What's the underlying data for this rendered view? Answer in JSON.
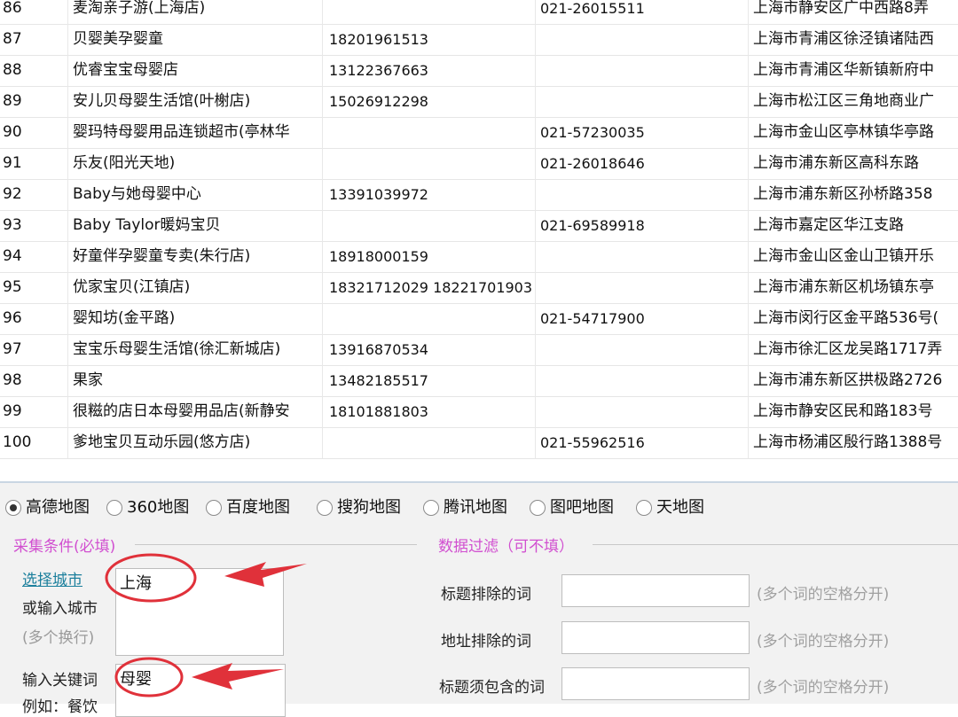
{
  "table": {
    "rows": [
      {
        "num": "86",
        "name": "麦淘亲子游(上海店)",
        "mobile": "",
        "tel": "021-26015511",
        "addr": "上海市静安区广中西路8弄"
      },
      {
        "num": "87",
        "name": "贝婴美孕婴童",
        "mobile": "18201961513",
        "tel": "",
        "addr": "上海市青浦区徐泾镇诸陆西"
      },
      {
        "num": "88",
        "name": "优睿宝宝母婴店",
        "mobile": "13122367663",
        "tel": "",
        "addr": "上海市青浦区华新镇新府中"
      },
      {
        "num": "89",
        "name": "安儿贝母婴生活馆(叶榭店)",
        "mobile": "15026912298",
        "tel": "",
        "addr": "上海市松江区三角地商业广"
      },
      {
        "num": "90",
        "name": "婴玛特母婴用品连锁超市(亭林华",
        "mobile": "",
        "tel": "021-57230035",
        "addr": "上海市金山区亭林镇华亭路"
      },
      {
        "num": "91",
        "name": "乐友(阳光天地)",
        "mobile": "",
        "tel": "021-26018646",
        "addr": "上海市浦东新区高科东路"
      },
      {
        "num": "92",
        "name": "Baby与她母婴中心",
        "mobile": "13391039972",
        "tel": "",
        "addr": "上海市浦东新区孙桥路358"
      },
      {
        "num": "93",
        "name": "Baby Taylor暖妈宝贝",
        "mobile": "",
        "tel": "021-69589918",
        "addr": "上海市嘉定区华江支路"
      },
      {
        "num": "94",
        "name": "好童伴孕婴童专卖(朱行店)",
        "mobile": "18918000159",
        "tel": "",
        "addr": "上海市金山区金山卫镇开乐"
      },
      {
        "num": "95",
        "name": "优家宝贝(江镇店)",
        "mobile": "18321712029 18221701903",
        "tel": "",
        "addr": "上海市浦东新区机场镇东亭"
      },
      {
        "num": "96",
        "name": "婴知坊(金平路)",
        "mobile": "",
        "tel": "021-54717900",
        "addr": "上海市闵行区金平路536号("
      },
      {
        "num": "97",
        "name": "宝宝乐母婴生活馆(徐汇新城店)",
        "mobile": "13916870534",
        "tel": "",
        "addr": "上海市徐汇区龙吴路1717弄"
      },
      {
        "num": "98",
        "name": "果家",
        "mobile": "13482185517",
        "tel": "",
        "addr": "上海市浦东新区拱极路2726"
      },
      {
        "num": "99",
        "name": "很糍的店日本母婴用品店(新静安",
        "mobile": "18101881803",
        "tel": "",
        "addr": "上海市静安区民和路183号"
      },
      {
        "num": "100",
        "name": "爹地宝贝互动乐园(悠方店)",
        "mobile": "",
        "tel": "021-55962516",
        "addr": "上海市杨浦区殷行路1388号"
      }
    ]
  },
  "map_sources": {
    "selected": "高德地图",
    "options": [
      "高德地图",
      "360地图",
      "百度地图",
      "搜狗地图",
      "腾讯地图",
      "图吧地图",
      "天地图"
    ]
  },
  "collect": {
    "title": "采集条件(必填)",
    "city_link": "选择城市",
    "city_or_input": "或输入城市",
    "multi_line_hint": "(多个换行)",
    "city_value": "上海",
    "keyword_label": "输入关键词",
    "keyword_example": "例如：餐饮",
    "keyword_value": "母婴"
  },
  "filter": {
    "title": "数据过滤（可不填）",
    "fields": [
      {
        "label": "标题排除的词",
        "value": "",
        "hint": "(多个词的空格分开)"
      },
      {
        "label": "地址排除的词",
        "value": "",
        "hint": "(多个词的空格分开)"
      },
      {
        "label": "标题须包含的词",
        "value": "",
        "hint": "(多个词的空格分开)"
      }
    ]
  },
  "colors": {
    "annotation_red": "#e0313a",
    "group_title": "#d14fd0",
    "link": "#1b7f9c"
  }
}
